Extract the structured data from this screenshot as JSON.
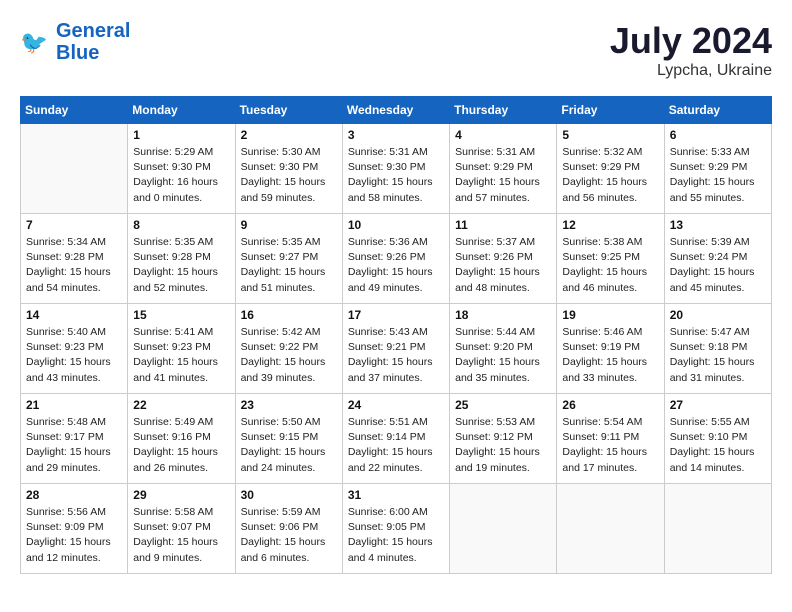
{
  "header": {
    "logo_line1": "General",
    "logo_line2": "Blue",
    "month_year": "July 2024",
    "location": "Lypcha, Ukraine"
  },
  "weekdays": [
    "Sunday",
    "Monday",
    "Tuesday",
    "Wednesday",
    "Thursday",
    "Friday",
    "Saturday"
  ],
  "weeks": [
    [
      {
        "day": "",
        "info": ""
      },
      {
        "day": "1",
        "info": "Sunrise: 5:29 AM\nSunset: 9:30 PM\nDaylight: 16 hours\nand 0 minutes."
      },
      {
        "day": "2",
        "info": "Sunrise: 5:30 AM\nSunset: 9:30 PM\nDaylight: 15 hours\nand 59 minutes."
      },
      {
        "day": "3",
        "info": "Sunrise: 5:31 AM\nSunset: 9:30 PM\nDaylight: 15 hours\nand 58 minutes."
      },
      {
        "day": "4",
        "info": "Sunrise: 5:31 AM\nSunset: 9:29 PM\nDaylight: 15 hours\nand 57 minutes."
      },
      {
        "day": "5",
        "info": "Sunrise: 5:32 AM\nSunset: 9:29 PM\nDaylight: 15 hours\nand 56 minutes."
      },
      {
        "day": "6",
        "info": "Sunrise: 5:33 AM\nSunset: 9:29 PM\nDaylight: 15 hours\nand 55 minutes."
      }
    ],
    [
      {
        "day": "7",
        "info": "Sunrise: 5:34 AM\nSunset: 9:28 PM\nDaylight: 15 hours\nand 54 minutes."
      },
      {
        "day": "8",
        "info": "Sunrise: 5:35 AM\nSunset: 9:28 PM\nDaylight: 15 hours\nand 52 minutes."
      },
      {
        "day": "9",
        "info": "Sunrise: 5:35 AM\nSunset: 9:27 PM\nDaylight: 15 hours\nand 51 minutes."
      },
      {
        "day": "10",
        "info": "Sunrise: 5:36 AM\nSunset: 9:26 PM\nDaylight: 15 hours\nand 49 minutes."
      },
      {
        "day": "11",
        "info": "Sunrise: 5:37 AM\nSunset: 9:26 PM\nDaylight: 15 hours\nand 48 minutes."
      },
      {
        "day": "12",
        "info": "Sunrise: 5:38 AM\nSunset: 9:25 PM\nDaylight: 15 hours\nand 46 minutes."
      },
      {
        "day": "13",
        "info": "Sunrise: 5:39 AM\nSunset: 9:24 PM\nDaylight: 15 hours\nand 45 minutes."
      }
    ],
    [
      {
        "day": "14",
        "info": "Sunrise: 5:40 AM\nSunset: 9:23 PM\nDaylight: 15 hours\nand 43 minutes."
      },
      {
        "day": "15",
        "info": "Sunrise: 5:41 AM\nSunset: 9:23 PM\nDaylight: 15 hours\nand 41 minutes."
      },
      {
        "day": "16",
        "info": "Sunrise: 5:42 AM\nSunset: 9:22 PM\nDaylight: 15 hours\nand 39 minutes."
      },
      {
        "day": "17",
        "info": "Sunrise: 5:43 AM\nSunset: 9:21 PM\nDaylight: 15 hours\nand 37 minutes."
      },
      {
        "day": "18",
        "info": "Sunrise: 5:44 AM\nSunset: 9:20 PM\nDaylight: 15 hours\nand 35 minutes."
      },
      {
        "day": "19",
        "info": "Sunrise: 5:46 AM\nSunset: 9:19 PM\nDaylight: 15 hours\nand 33 minutes."
      },
      {
        "day": "20",
        "info": "Sunrise: 5:47 AM\nSunset: 9:18 PM\nDaylight: 15 hours\nand 31 minutes."
      }
    ],
    [
      {
        "day": "21",
        "info": "Sunrise: 5:48 AM\nSunset: 9:17 PM\nDaylight: 15 hours\nand 29 minutes."
      },
      {
        "day": "22",
        "info": "Sunrise: 5:49 AM\nSunset: 9:16 PM\nDaylight: 15 hours\nand 26 minutes."
      },
      {
        "day": "23",
        "info": "Sunrise: 5:50 AM\nSunset: 9:15 PM\nDaylight: 15 hours\nand 24 minutes."
      },
      {
        "day": "24",
        "info": "Sunrise: 5:51 AM\nSunset: 9:14 PM\nDaylight: 15 hours\nand 22 minutes."
      },
      {
        "day": "25",
        "info": "Sunrise: 5:53 AM\nSunset: 9:12 PM\nDaylight: 15 hours\nand 19 minutes."
      },
      {
        "day": "26",
        "info": "Sunrise: 5:54 AM\nSunset: 9:11 PM\nDaylight: 15 hours\nand 17 minutes."
      },
      {
        "day": "27",
        "info": "Sunrise: 5:55 AM\nSunset: 9:10 PM\nDaylight: 15 hours\nand 14 minutes."
      }
    ],
    [
      {
        "day": "28",
        "info": "Sunrise: 5:56 AM\nSunset: 9:09 PM\nDaylight: 15 hours\nand 12 minutes."
      },
      {
        "day": "29",
        "info": "Sunrise: 5:58 AM\nSunset: 9:07 PM\nDaylight: 15 hours\nand 9 minutes."
      },
      {
        "day": "30",
        "info": "Sunrise: 5:59 AM\nSunset: 9:06 PM\nDaylight: 15 hours\nand 6 minutes."
      },
      {
        "day": "31",
        "info": "Sunrise: 6:00 AM\nSunset: 9:05 PM\nDaylight: 15 hours\nand 4 minutes."
      },
      {
        "day": "",
        "info": ""
      },
      {
        "day": "",
        "info": ""
      },
      {
        "day": "",
        "info": ""
      }
    ]
  ]
}
